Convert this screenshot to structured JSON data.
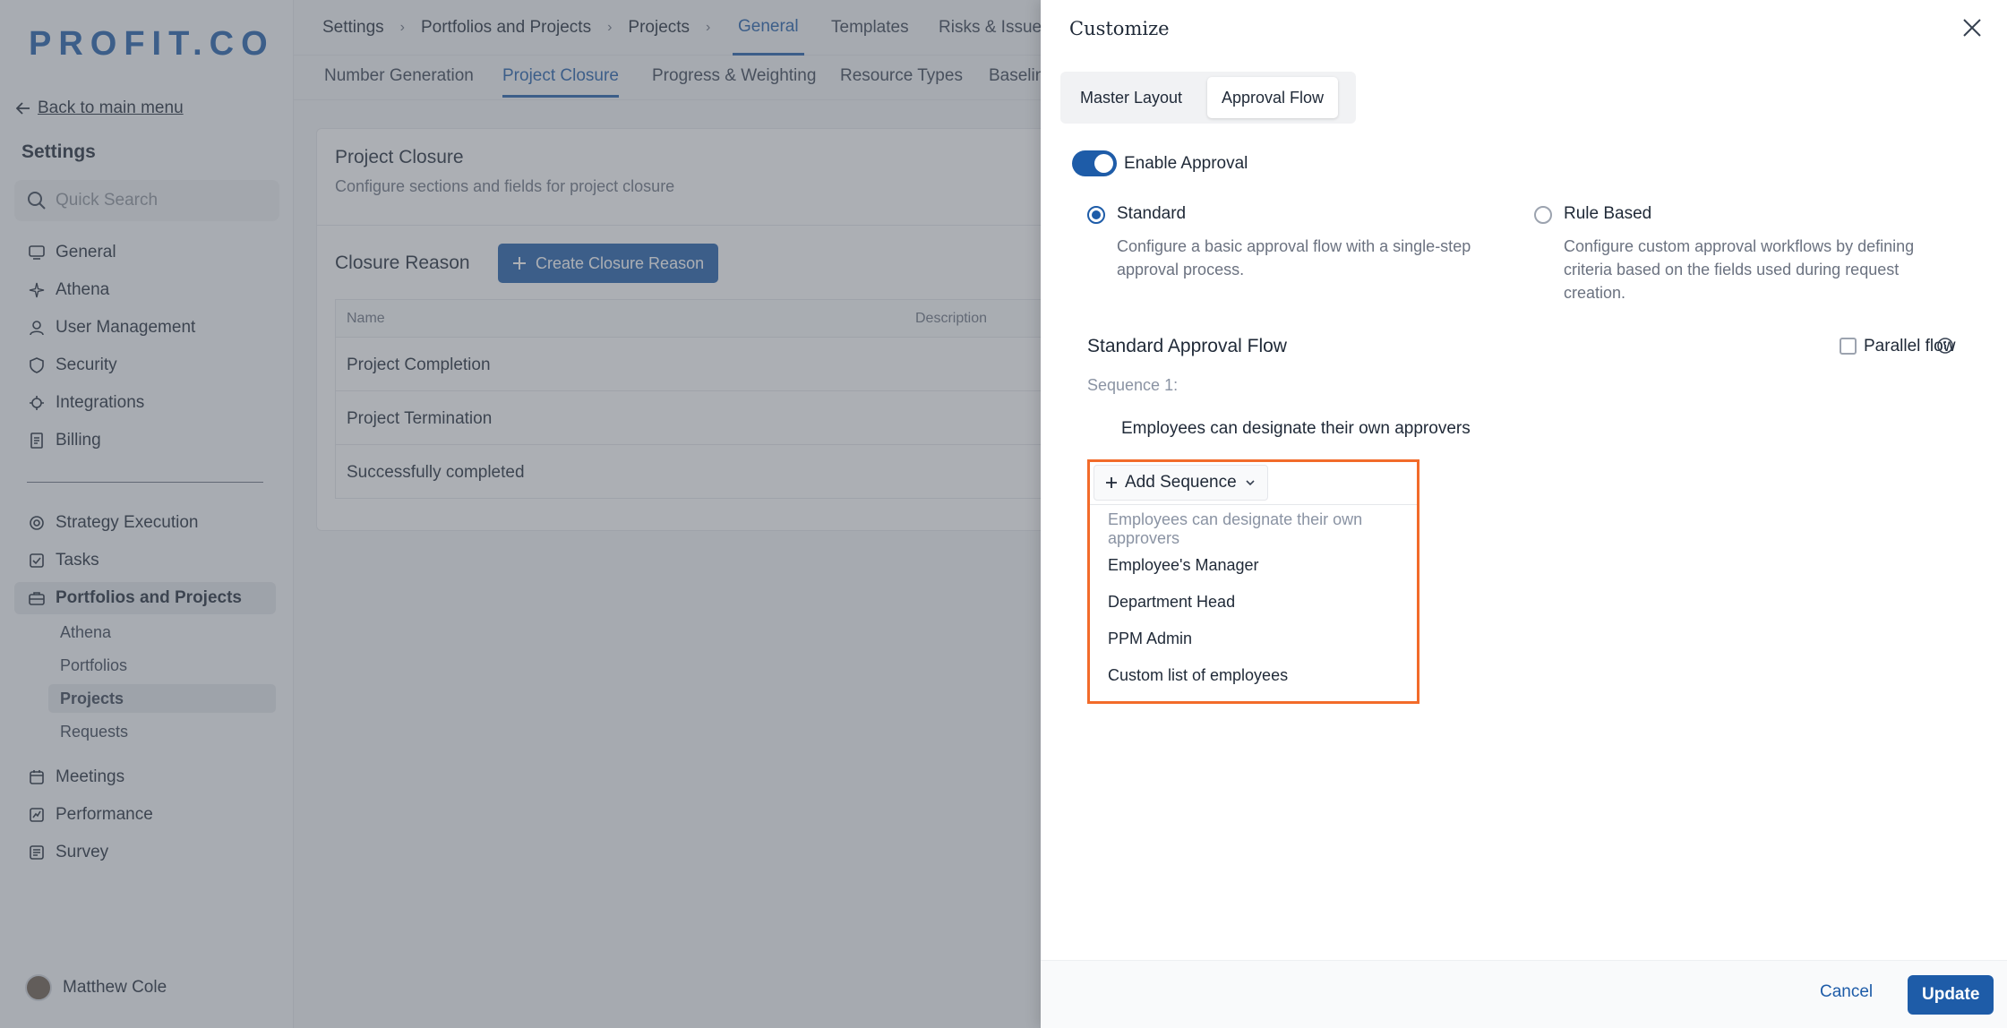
{
  "brand": {
    "logo": "PROFIT.CO",
    "accent": "#1e5ca8",
    "highlight": "#f26b2a"
  },
  "sidebar": {
    "back_label": "Back to main menu",
    "heading": "Settings",
    "search_placeholder": "Quick Search",
    "items": [
      {
        "label": "General",
        "icon": "monitor-icon"
      },
      {
        "label": "Athena",
        "icon": "sparkle-icon"
      },
      {
        "label": "User Management",
        "icon": "user-icon"
      },
      {
        "label": "Security",
        "icon": "shield-icon"
      },
      {
        "label": "Integrations",
        "icon": "puzzle-icon"
      },
      {
        "label": "Billing",
        "icon": "receipt-icon"
      }
    ],
    "items2": [
      {
        "label": "Strategy Execution",
        "icon": "target-icon"
      },
      {
        "label": "Tasks",
        "icon": "checklist-icon"
      },
      {
        "label": "Portfolios and Projects",
        "icon": "briefcase-icon"
      }
    ],
    "sub_items": [
      "Athena",
      "Portfolios",
      "Projects",
      "Requests"
    ],
    "items3": [
      {
        "label": "Meetings",
        "icon": "calendar-icon"
      },
      {
        "label": "Performance",
        "icon": "chart-icon"
      },
      {
        "label": "Survey",
        "icon": "survey-icon"
      }
    ],
    "user_name": "Matthew Cole"
  },
  "main": {
    "breadcrumbs": [
      "Settings",
      "Portfolios and Projects",
      "Projects"
    ],
    "top_tabs": [
      "General",
      "Templates",
      "Risks & Issues"
    ],
    "sub_tabs": [
      "Number Generation",
      "Project Closure",
      "Progress & Weighting",
      "Resource Types",
      "Baselin"
    ],
    "card": {
      "title": "Project Closure",
      "subtitle": "Configure sections and fields for project closure",
      "closure_label": "Closure Reason",
      "create_button": "Create Closure Reason",
      "columns": [
        "Name",
        "Description"
      ],
      "rows": [
        "Project Completion",
        "Project Termination",
        "Successfully completed"
      ]
    }
  },
  "drawer": {
    "title": "Customize",
    "tabs": [
      "Master Layout",
      "Approval Flow"
    ],
    "enable_label": "Enable Approval",
    "standard": {
      "title": "Standard",
      "description": "Configure a basic approval flow with a single-step approval process."
    },
    "rule_based": {
      "title": "Rule Based",
      "description": "Configure custom approval workflows by defining criteria based on the fields used during request creation."
    },
    "flow_title": "Standard Approval Flow",
    "parallel_label": "Parallel flow",
    "sequence_label": "Sequence 1:",
    "sequence_value": "Employees can designate their own approvers",
    "add_sequence_label": "Add Sequence",
    "menu": [
      "Employees can designate their own approvers",
      "Employee's Manager",
      "Department Head",
      "PPM Admin",
      "Custom list of employees"
    ],
    "cancel_label": "Cancel",
    "update_label": "Update"
  }
}
